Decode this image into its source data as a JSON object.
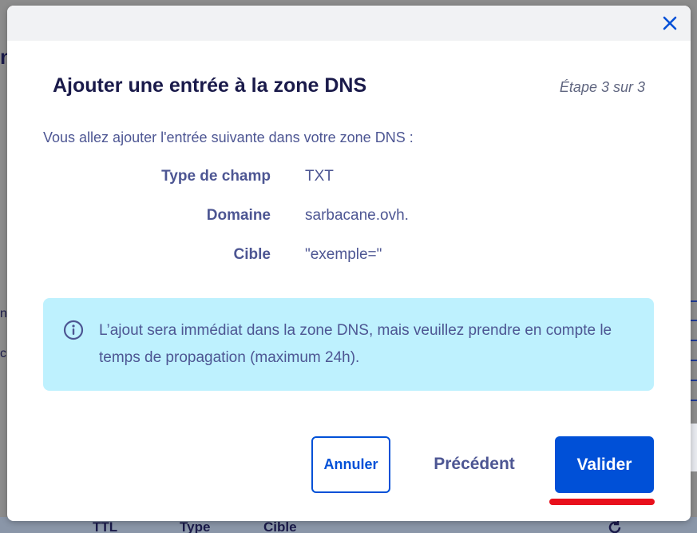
{
  "modal": {
    "title": "Ajouter une entrée à la zone DNS",
    "step": "Étape 3 sur 3",
    "intro": "Vous allez ajouter l'entrée suivante dans votre zone DNS :",
    "fields": [
      {
        "label": "Type de champ",
        "value": "TXT"
      },
      {
        "label": "Domaine",
        "value": "sarbacane.ovh."
      },
      {
        "label": "Cible",
        "value": "\"exemple=\""
      }
    ],
    "info": "L’ajout sera immédiat dans la zone DNS, mais veuillez prendre en compte le temps de propagation (maximum 24h).",
    "buttons": {
      "cancel": "Annuler",
      "previous": "Précédent",
      "validate": "Valider"
    }
  },
  "background": {
    "table_headers": [
      "TTL",
      "Type",
      "Cible"
    ]
  },
  "colors": {
    "primary": "#0050d7",
    "text": "#4d5693",
    "title": "#1a1a4a",
    "info_bg": "#bef1fe",
    "highlight": "#e8101c"
  },
  "icons": {
    "close": "close-icon",
    "info": "info-circle-icon",
    "refresh": "refresh-icon"
  }
}
